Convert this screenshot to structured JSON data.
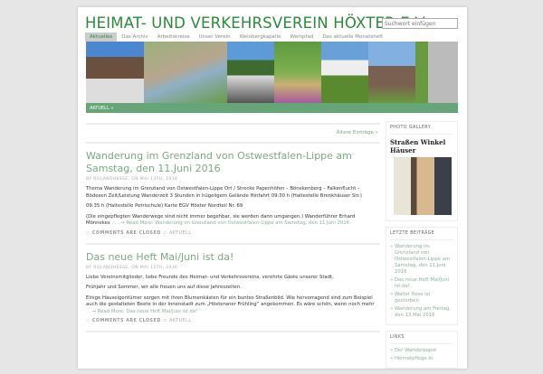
{
  "header": {
    "title": "HEIMAT- UND VERKEHRSVEREIN HÖXTER E.V.",
    "search_placeholder": "Suchwort einfügen"
  },
  "nav": [
    "Aktuelles",
    "Das Archiv",
    "Arbeitskreise",
    "Unser Verein",
    "Weinbergkapelle",
    "Weinpfad",
    "Das aktuelle Monatsheft"
  ],
  "breadcrumb": "AKTUELL »",
  "older": "Ältere Einträge »",
  "posts": [
    {
      "title": "Wanderung im Grenzland von Ostwestfalen-Lippe am Samstag, den 11.Juni 2016",
      "meta": "BY ROLANDHESSE, ON MAI 13TH, 2016",
      "p1": "Thema Wanderung im Grenzland von Ostwestfalen-Lippe Ort / Strecke Papenhöfen – Bönekenberg – Falkenflucht – Bödexen Zeit/Leistung Wanderzeit 3 Stunden in hügeligem Gelände Hinfahrt 09:30 h (Haltestelle Brenkhäuser Str.)",
      "p2": "09:35 h (Haltestelle Petrischule) Karte EGV Höxter Nordteil Nr. 69",
      "p3": "(Die  eingepflegten Wanderwege sind nicht immer begehbar, sie werden dann umgangen.) Wanderführer Erhard Mönnekes",
      "more": ". . . → Read More: Wanderung im Grenzland von Ostwestfalen-Lippe am Samstag, den 11.Juni 2016",
      "comments": "COMMENTS ARE CLOSED",
      "category": "AKTUELL"
    },
    {
      "title": "Das neue Heft Mai/Juni ist da!",
      "meta": "BY ROLANDHESSE, ON MAI 11TH, 2016",
      "p1": "Liebe Vereinsmitglieder, liebe Freunde des Heimat- und Verkehrsvereins, verehrte Gäste unserer Stadt,",
      "p2": "Frühjahr und Sommer, wir alle freuen uns auf diese Jahreszeiten.",
      "p3": "Einige Hauseigentümer sorgen mit ihren Blumenkästen für ein buntes Straßenbild. Wie hervorragend sind zum Beispiel auch die gestalteten Beete in der Innenstadt zum „Höxteraner Frühling“ angekommen. Es wäre schön, wenn noch mehr",
      "more": ". . . → Read More: Das neue Heft Mai/Juni ist da!",
      "comments": "COMMENTS ARE CLOSED",
      "category": "AKTUELL"
    }
  ],
  "sidebar": {
    "gallery_title": "PHOTO GALLERY",
    "gallery_name": "Straßen Winkel Häuser",
    "recent_title": "LETZTE BEITRÄGE",
    "recent": [
      "Wanderung im Grenzland von Ostwestfalen-Lippe am Samstag, den 11.Juni 2016",
      "Das neue Heft Mai/Juni ist da!",
      "Walter Rose ist gestorben",
      "Wanderung am Freitag, den 13.Mai 2016"
    ],
    "links_title": "LINKS",
    "links": [
      "Der Wanderpapst",
      "Heimatpflege in"
    ]
  }
}
